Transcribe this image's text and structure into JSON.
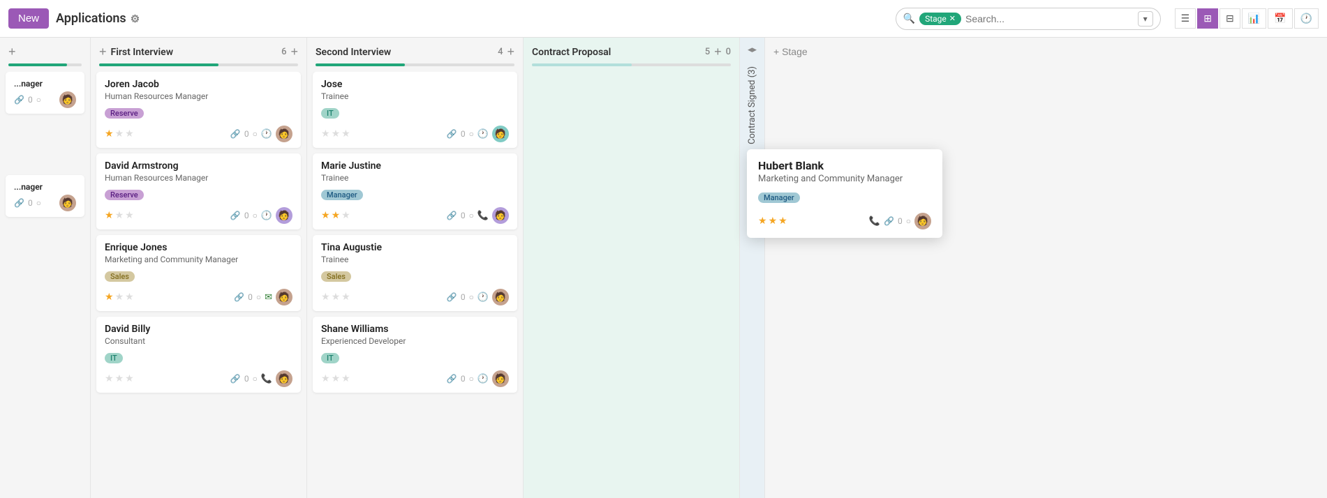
{
  "header": {
    "new_label": "New",
    "app_title": "Applications",
    "gear_symbol": "⚙",
    "search": {
      "stage_filter": "Stage",
      "placeholder": "Search..."
    },
    "views": {
      "list": "☰",
      "kanban": "⊞",
      "table": "⊟",
      "graph": "📊",
      "calendar": "📅",
      "activity": "🕐"
    }
  },
  "board": {
    "columns": [
      {
        "id": "first-interview",
        "title": "First Interview",
        "count": 6,
        "progress": 60,
        "cards": [
          {
            "name": "Joren Jacob",
            "role": "Human Resources Manager",
            "tag": "Reserve",
            "tag_type": "reserve",
            "stars": 1,
            "max_stars": 3,
            "has_clock": true,
            "avatar_type": "brown"
          },
          {
            "name": "David Armstrong",
            "role": "Human Resources Manager",
            "tag": "Reserve",
            "tag_type": "reserve",
            "stars": 1,
            "max_stars": 3,
            "has_clock": true,
            "avatar_type": "purple"
          },
          {
            "name": "Enrique Jones",
            "role": "Marketing and Community Manager",
            "tag": "Sales",
            "tag_type": "sales",
            "stars": 1,
            "max_stars": 3,
            "has_email": true,
            "avatar_type": "brown"
          },
          {
            "name": "David Billy",
            "role": "Consultant",
            "tag": "IT",
            "tag_type": "it",
            "stars": 0,
            "max_stars": 3,
            "has_phone": true,
            "avatar_type": "brown"
          }
        ]
      },
      {
        "id": "second-interview",
        "title": "Second Interview",
        "count": 4,
        "progress": 45,
        "cards": [
          {
            "name": "Jose",
            "role": "Trainee",
            "tag": "IT",
            "tag_type": "it",
            "stars": 0,
            "max_stars": 3,
            "has_clock": true,
            "avatar_type": "teal"
          },
          {
            "name": "Marie Justine",
            "role": "Trainee",
            "tag": "Manager",
            "tag_type": "manager",
            "stars": 2,
            "max_stars": 3,
            "has_phone": true,
            "avatar_type": "purple"
          },
          {
            "name": "Tina Augustie",
            "role": "Trainee",
            "tag": "Sales",
            "tag_type": "sales",
            "stars": 0,
            "max_stars": 3,
            "has_clock": true,
            "avatar_type": "brown"
          },
          {
            "name": "Shane Williams",
            "role": "Experienced Developer",
            "tag": "IT",
            "tag_type": "it",
            "stars": 0,
            "max_stars": 3,
            "has_clock": true,
            "avatar_type": "brown2"
          }
        ]
      },
      {
        "id": "contract-proposal",
        "title": "Contract Proposal",
        "count": 5,
        "progress": 50,
        "is_contract": true,
        "cards": []
      }
    ],
    "collapsed_column": {
      "title": "Contract Signed (3)"
    },
    "add_stage_label": "+ Stage",
    "popup": {
      "name": "Hubert Blank",
      "role": "Marketing and Community Manager",
      "tag": "Manager",
      "tag_type": "manager",
      "stars": 3,
      "max_stars": 3,
      "has_phone": true
    }
  }
}
